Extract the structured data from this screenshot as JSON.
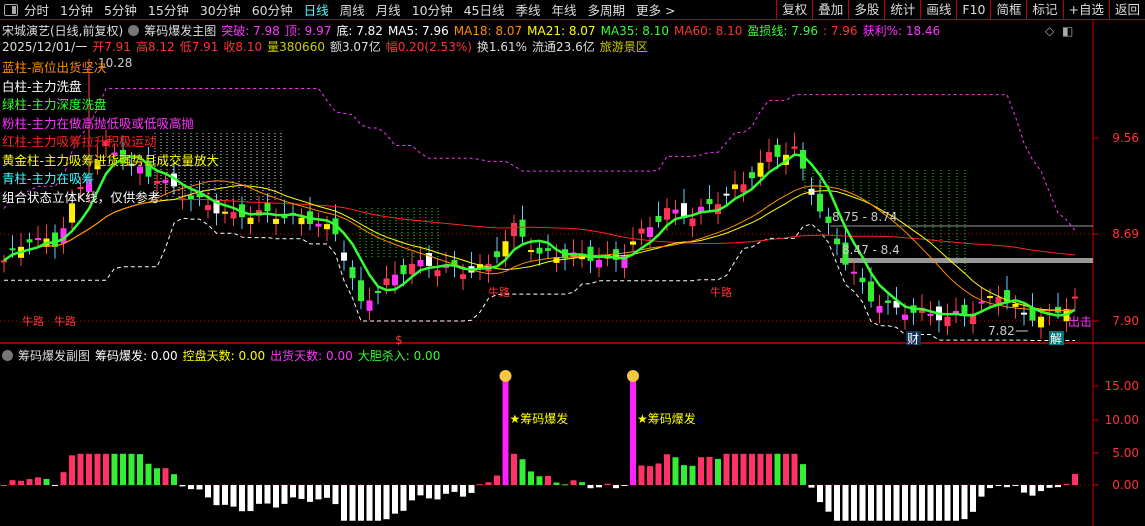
{
  "toolbar": {
    "periods": [
      "分时",
      "1分钟",
      "5分钟",
      "15分钟",
      "30分钟",
      "60分钟",
      "日线",
      "周线",
      "月线",
      "10分钟",
      "45日线",
      "季线",
      "年线",
      "多周期",
      "更多 >"
    ],
    "active": "日线",
    "buttons": [
      "复权",
      "叠加",
      "多股",
      "统计",
      "画线",
      "F10",
      "简框",
      "标记",
      "+自选",
      "返回"
    ]
  },
  "info1": [
    {
      "t": "宋城演艺(日线,前复权)",
      "c": "#dddddd"
    },
    {
      "t": "筹码爆发主图",
      "c": "#dddddd"
    },
    {
      "t": "突破: 7.98",
      "c": "#ff33ff"
    },
    {
      "t": "顶: 9.97",
      "c": "#ff33ff"
    },
    {
      "t": "底: 7.82",
      "c": "#ffffff"
    },
    {
      "t": "MA5: 7.96",
      "c": "#ffffff"
    },
    {
      "t": "MA18: 8.07",
      "c": "#ff8c00"
    },
    {
      "t": "MA21: 8.07",
      "c": "#ffff00"
    },
    {
      "t": "MA35: 8.10",
      "c": "#33ff33"
    },
    {
      "t": "MA60: 8.10",
      "c": "#ff3333"
    },
    {
      "t": "盈损线: 7.96",
      "c": "#33ff33"
    },
    {
      "t": ": 7.96",
      "c": "#ff3333"
    },
    {
      "t": "获利%: 18.46",
      "c": "#ff33ff"
    }
  ],
  "info2": [
    {
      "t": "2025/12/01/一",
      "c": "#dddddd"
    },
    {
      "t": "开7.91",
      "c": "#ff3333"
    },
    {
      "t": "高8.12",
      "c": "#ff3333"
    },
    {
      "t": "低7.91",
      "c": "#ff3333"
    },
    {
      "t": "收8.10",
      "c": "#ff3333"
    },
    {
      "t": "量380660",
      "c": "#cccc00"
    },
    {
      "t": "额3.07亿",
      "c": "#dddddd"
    },
    {
      "t": "幅0.20(2.53%)",
      "c": "#ff3333"
    },
    {
      "t": "换1.61%",
      "c": "#dddddd"
    },
    {
      "t": "流通23.6亿",
      "c": "#dddddd"
    },
    {
      "t": "旅游景区",
      "c": "#cccc00"
    }
  ],
  "legend": [
    {
      "t": "蓝柱-高位出货坚决",
      "c": "#ff8c00"
    },
    {
      "t": "白柱-主力洗盘",
      "c": "#ffffff"
    },
    {
      "t": "绿柱-主力深度洗盘",
      "c": "#33ff33"
    },
    {
      "t": "粉柱-主力在做高抛低吸或低吸高抛",
      "c": "#ff33ff"
    },
    {
      "t": "红柱-主力吸筹拉升积极运动",
      "c": "#ff2222"
    },
    {
      "t": "黄金柱-主力吸筹进货强势且成交量放大",
      "c": "#ffff00"
    },
    {
      "t": "青柱-主力在吸筹",
      "c": "#33ffff"
    },
    {
      "t": "组合状态立体K线，仅供参考",
      "c": "#ffffff"
    }
  ],
  "annotations": {
    "high": "10.28",
    "zone1": "8.75 - 8.74",
    "zone2": "8.47 - 8.4",
    "low": "7.82",
    "niulu": "牛路",
    "dollar": "$",
    "cai": "财",
    "jie": "解",
    "chuji": "出击",
    "burst": "★筹码爆发"
  },
  "price_axis": [
    "9.56",
    "8.69",
    "7.90"
  ],
  "sub_axis": [
    "15.00",
    "10.00",
    "5.00",
    "0.00"
  ],
  "sub_info": [
    {
      "t": "筹码爆发副图",
      "c": "#dddddd"
    },
    {
      "t": "筹码爆发: 0.00",
      "c": "#ffffff"
    },
    {
      "t": "控盘天数: 0.00",
      "c": "#ffff00"
    },
    {
      "t": "出货天数: 0.00",
      "c": "#ff33ff"
    },
    {
      "t": "大胆杀入: 0.00",
      "c": "#33ff33"
    }
  ],
  "chart_data": {
    "type": "candlestick",
    "close_approx": [
      8.45,
      8.65,
      8.6,
      9.1,
      9.5,
      9.3,
      9.2,
      9.05,
      8.95,
      8.85,
      8.88,
      8.85,
      8.82,
      8.7,
      8.05,
      8.25,
      8.42,
      8.4,
      8.35,
      8.4,
      8.75,
      8.5,
      8.5,
      8.48,
      8.45,
      8.7,
      8.9,
      8.85,
      9.0,
      9.15,
      9.4,
      9.45,
      8.9,
      8.45,
      8.1,
      8.0,
      7.98,
      7.93,
      8.0,
      8.15,
      7.95,
      7.93,
      8.1
    ],
    "sub_bursts": [
      16,
      16
    ],
    "sub_ylim": [
      -6,
      18
    ],
    "colors": {
      "up": "#ff3333",
      "down": "#33ee33",
      "ma5": "#33ff33",
      "ma18": "#ff8c00",
      "ma21": "#ffff00",
      "ma60": "#ff2222"
    }
  }
}
